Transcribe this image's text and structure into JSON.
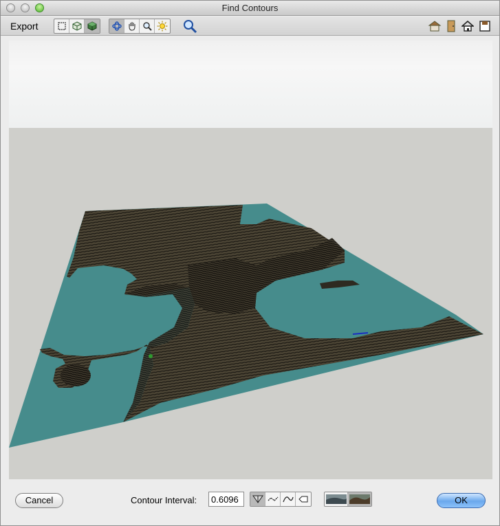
{
  "window": {
    "title": "Find Contours"
  },
  "toolbar": {
    "export_label": "Export",
    "view_buttons": [
      "rect-select-icon",
      "cube-wire-icon",
      "cube-solid-icon"
    ],
    "nav_buttons": [
      "orbit-icon",
      "hand-pan-icon",
      "zoom-icon",
      "sun-icon"
    ],
    "zoom_fit": "zoom-extents-icon",
    "right_icons": [
      "house-3d-icon",
      "door-icon",
      "home-icon",
      "save-icon"
    ]
  },
  "bottom": {
    "cancel_label": "Cancel",
    "contour_interval_label": "Contour Interval:",
    "contour_interval_value": "0.6096",
    "ok_label": "OK",
    "tool_buttons": [
      "triangle-mesh-icon",
      "polyline-icon",
      "smooth-curve-icon",
      "eraser-icon"
    ],
    "thumbnails": [
      "terrain-thumb-1",
      "terrain-thumb-2"
    ]
  },
  "colors": {
    "water": "#468c8c",
    "terrain": "#3b352a",
    "background": "#cfcfcb",
    "ok_button": "#6aa8ec"
  }
}
